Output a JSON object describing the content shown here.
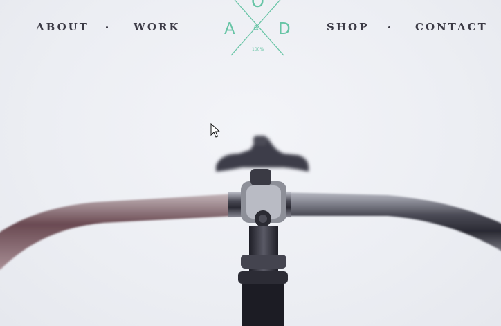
{
  "nav": {
    "left": [
      {
        "label": "ABOUT"
      },
      {
        "label": "WORK"
      }
    ],
    "right": [
      {
        "label": "SHOP"
      },
      {
        "label": "CONTACT"
      }
    ]
  },
  "logo": {
    "letter_top": "O",
    "letter_left": "A",
    "letter_right": "D",
    "ampersand": "&",
    "tagline": "100%",
    "color": "#66c4a5"
  },
  "hero": {
    "image": "bicycle-handlebar-photo"
  },
  "colors": {
    "nav_text": "#3b3a45",
    "background": "#eef0f4"
  }
}
